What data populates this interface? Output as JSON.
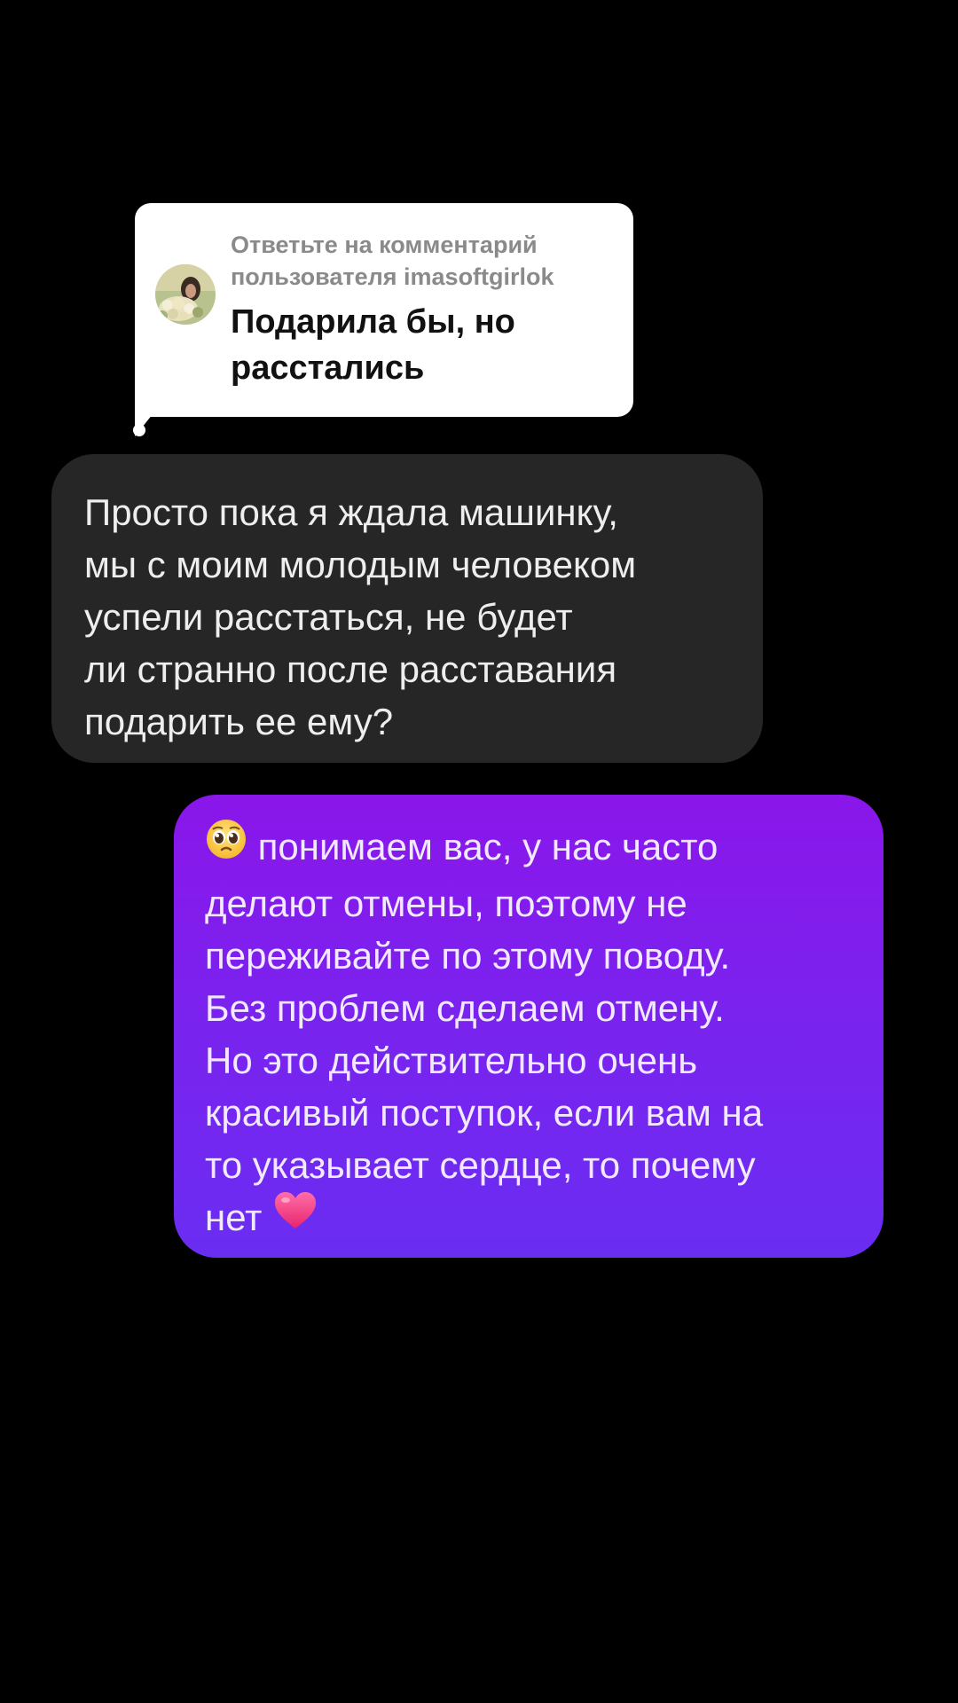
{
  "reply_card": {
    "header_line1": "Ответьте на комментарий",
    "header_line2": "пользователя imasoftgirlok",
    "comment_line1": "Подарила бы, но",
    "comment_line2": "расстались"
  },
  "incoming_message": {
    "lines": [
      "Просто пока я ждала машинку,",
      "мы с моим молодым человеком",
      "успели расстаться, не будет",
      "ли странно после расставания",
      "подарить ее ему?"
    ]
  },
  "outgoing_message": {
    "lead_emoji": "pleading-face-emoji",
    "lines": [
      "понимаем вас, у нас часто",
      "делают отмены, поэтому не",
      "переживайте по этому поводу.",
      "Без проблем сделаем отмену.",
      "Но это действительно очень",
      "красивый поступок, если вам на",
      "то указывает сердце, то почему",
      "нет"
    ],
    "trail_emoji": "pink-heart-emoji"
  },
  "colors": {
    "background": "#000000",
    "reply_card": "#ffffff",
    "incoming_bubble": "#262626",
    "outgoing_bubble_top": "#8a16ea",
    "outgoing_bubble_bottom": "#6a2df2"
  }
}
